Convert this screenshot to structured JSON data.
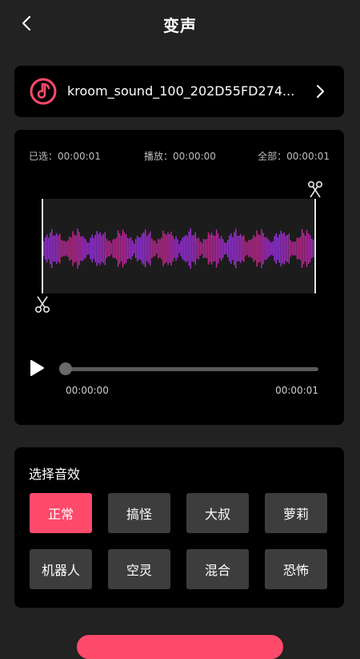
{
  "header": {
    "title": "变声",
    "back_icon": "chevron-left-icon"
  },
  "file": {
    "name": "kroom_sound_100_202D55FD274...",
    "icon": "music-note-icon",
    "accent": "#ff4a6b"
  },
  "times": {
    "selected_label": "已选：00:00:01",
    "play_label": "播放：00:00:00",
    "total_label": "全部：00:00:01"
  },
  "waveform": {
    "colors": [
      "#8e3cff",
      "#c025ff",
      "#ff1f4b"
    ],
    "trim_start_icon": "scissors-icon",
    "trim_end_icon": "scissors-icon"
  },
  "player": {
    "play_icon": "play-icon",
    "current_time": "00:00:00",
    "end_time": "00:00:01",
    "progress": 0
  },
  "effects": {
    "title": "选择音效",
    "items": [
      {
        "label": "正常",
        "active": true
      },
      {
        "label": "搞怪",
        "active": false
      },
      {
        "label": "大叔",
        "active": false
      },
      {
        "label": "萝莉",
        "active": false
      },
      {
        "label": "机器人",
        "active": false
      },
      {
        "label": "空灵",
        "active": false
      },
      {
        "label": "混合",
        "active": false
      },
      {
        "label": "恐怖",
        "active": false
      }
    ]
  }
}
